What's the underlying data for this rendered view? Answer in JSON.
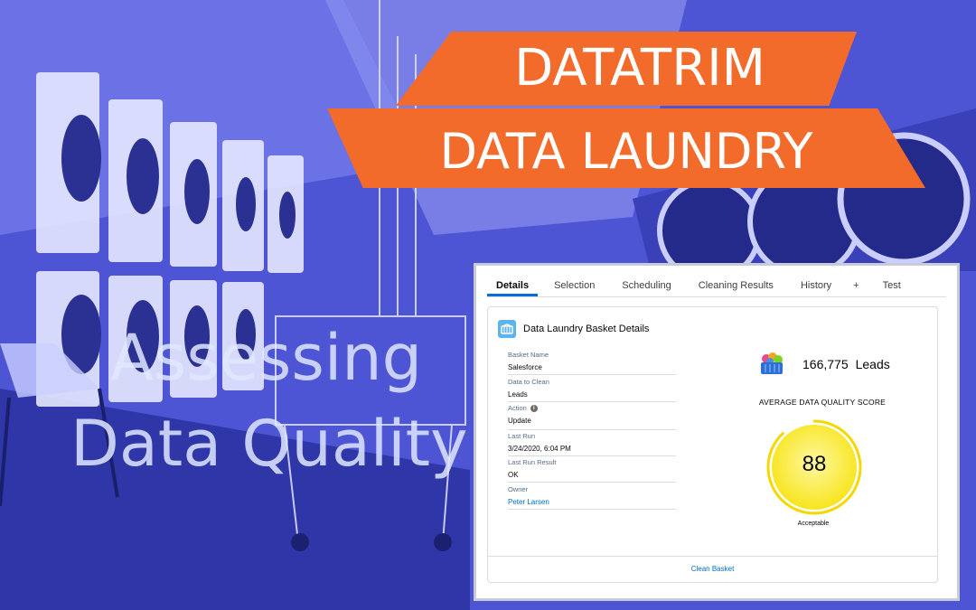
{
  "banner": {
    "line1": "DATATRIM",
    "line2": "DATA LAUNDRY",
    "color": "#f26b2a"
  },
  "headline": {
    "line1": "Assessing",
    "line2": "Data Quality"
  },
  "tabs": [
    {
      "label": "Details",
      "active": true
    },
    {
      "label": "Selection"
    },
    {
      "label": "Scheduling"
    },
    {
      "label": "Cleaning Results"
    },
    {
      "label": "History"
    },
    {
      "label": "+"
    },
    {
      "label": "Test"
    }
  ],
  "card": {
    "icon": "basket-icon",
    "title": "Data Laundry Basket Details",
    "fields": [
      {
        "label": "Basket Name",
        "value": "Salesforce"
      },
      {
        "label": "Data to Clean",
        "value": "Leads"
      },
      {
        "label": "Action",
        "value": "Update",
        "info_icon": "info-icon"
      },
      {
        "label": "Last Run",
        "value": "3/24/2020, 6:04 PM"
      },
      {
        "label": "Last Run Result",
        "value": "OK"
      },
      {
        "label": "Owner",
        "value": "Peter Larsen",
        "link": true
      }
    ],
    "stat": {
      "icon": "colorful-basket-icon",
      "count": "166,775",
      "unit": "Leads"
    },
    "score": {
      "label": "AVERAGE DATA QUALITY SCORE",
      "value": "88",
      "fraction": 0.88,
      "rating": "Acceptable",
      "ring_color": "#f5d800",
      "fill_color": "#fff34a"
    },
    "action_button": "Clean Basket"
  }
}
